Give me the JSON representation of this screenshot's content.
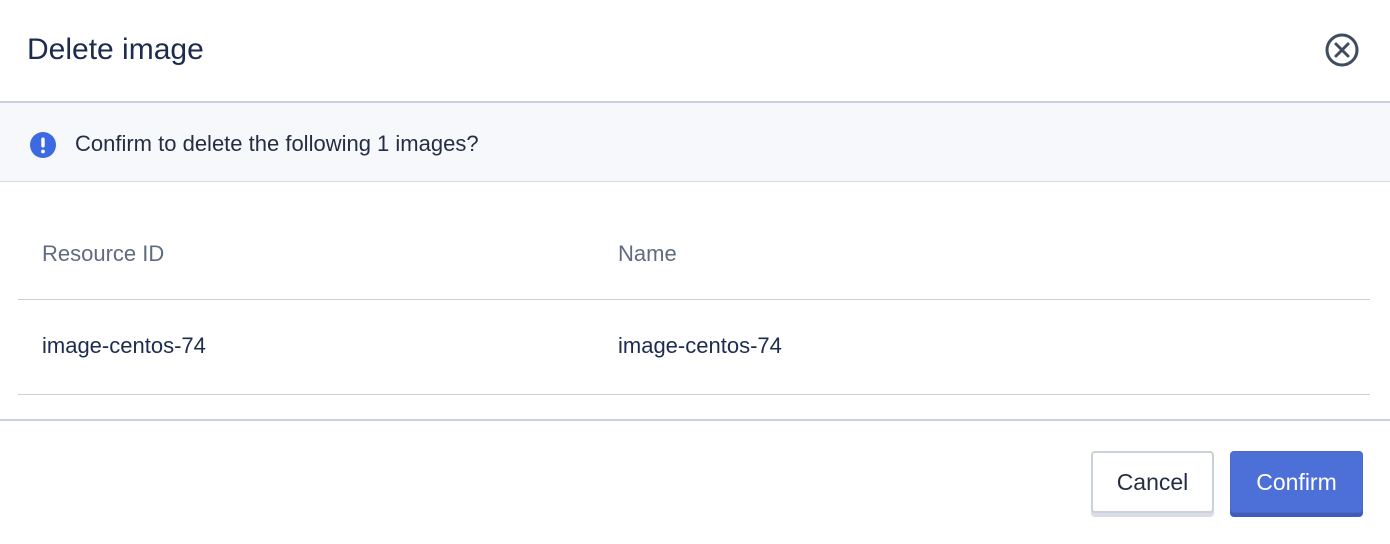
{
  "dialog": {
    "title": "Delete image",
    "close_icon": "close-circle-icon"
  },
  "alert": {
    "icon": "info-exclamation-icon",
    "message": "Confirm to delete the following 1 images?",
    "icon_color": "#3e6ae1"
  },
  "table": {
    "columns": [
      "Resource ID",
      "Name"
    ],
    "rows": [
      [
        "image-centos-74",
        "image-centos-74"
      ]
    ]
  },
  "footer": {
    "cancel_label": "Cancel",
    "confirm_label": "Confirm",
    "confirm_color": "#4d6fd8"
  }
}
